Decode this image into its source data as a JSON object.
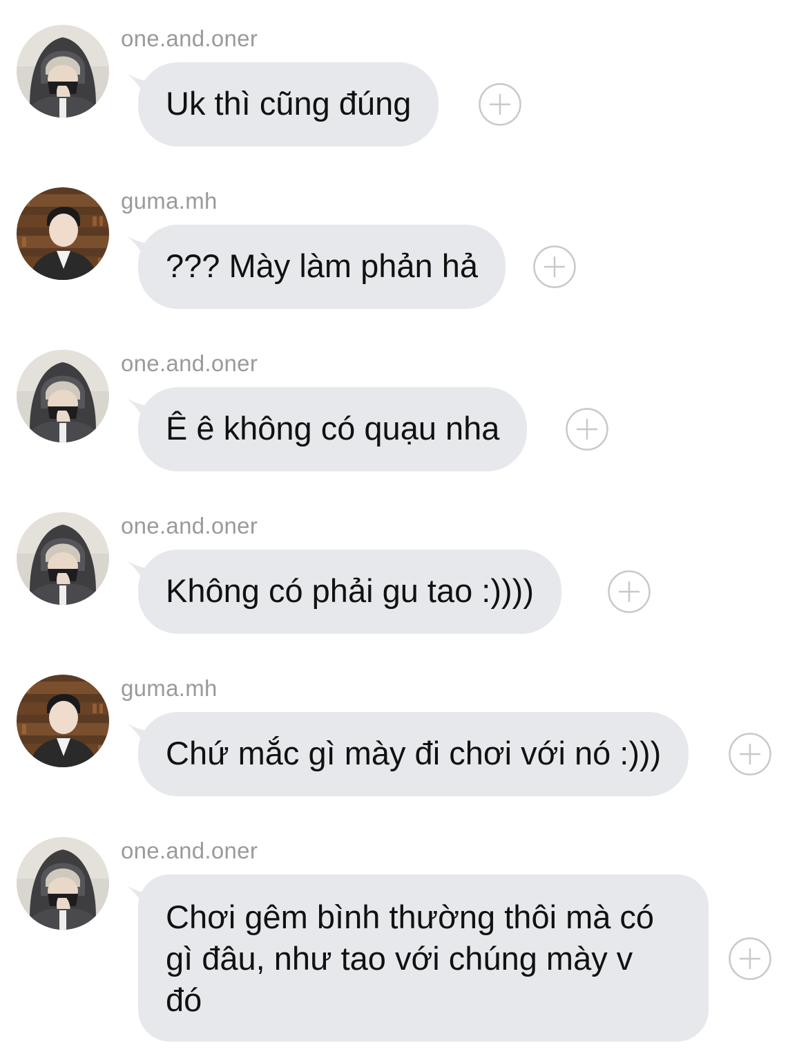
{
  "messages": [
    {
      "username": "one.and.oner",
      "text": "Uk thì cũng đúng",
      "avatar_icon": "hooded-user-avatar"
    },
    {
      "username": "guma.mh",
      "text": "??? Mày làm phản hả",
      "avatar_icon": "library-user-avatar"
    },
    {
      "username": "one.and.oner",
      "text": "Ê ê không có quạu nha",
      "avatar_icon": "hooded-user-avatar"
    },
    {
      "username": "one.and.oner",
      "text": "Không có phải gu tao :))))",
      "avatar_icon": "hooded-user-avatar"
    },
    {
      "username": "guma.mh",
      "text": "Chứ mắc gì mày đi chơi với nó :)))",
      "avatar_icon": "library-user-avatar"
    },
    {
      "username": "one.and.oner",
      "text_lines": [
        "Chơi gêm bình thường thôi mà có",
        "gì đâu, như tao với chúng mày v",
        "đó"
      ],
      "avatar_icon": "hooded-user-avatar"
    }
  ],
  "colors": {
    "bubble": "#e6e8eb",
    "username": "#9a9a9a",
    "text": "#111111",
    "react_icon": "#c8c8c8"
  },
  "icons": {
    "react": "add-reaction-icon"
  }
}
